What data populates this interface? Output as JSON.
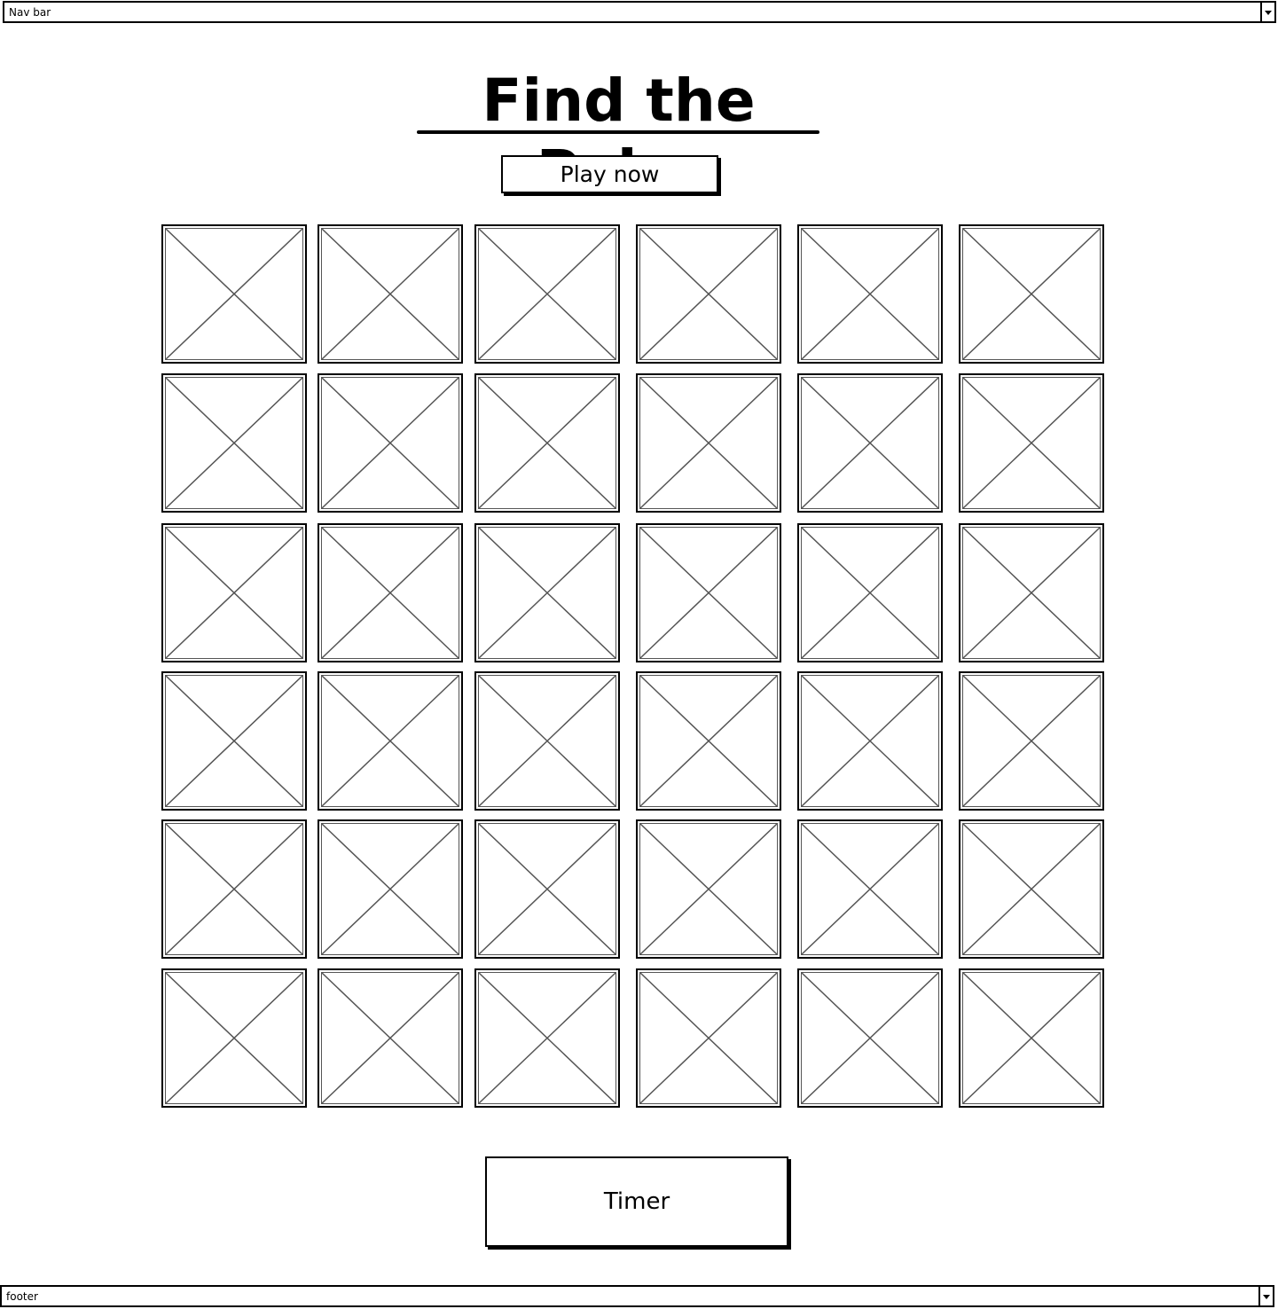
{
  "nav": {
    "label": "Nav bar",
    "icon": "chevron-down-icon"
  },
  "title": "Find the Pairs",
  "play_button": "Play now",
  "timer": "Timer",
  "footer": {
    "label": "footer",
    "icon": "chevron-down-icon"
  },
  "grid": {
    "rows": 6,
    "columns": 6,
    "card_icon": "image-placeholder-icon"
  }
}
